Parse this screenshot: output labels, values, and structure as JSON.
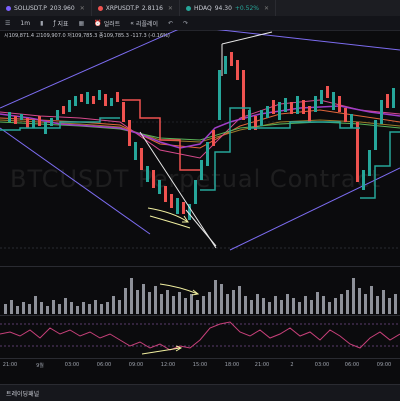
{
  "tabs": [
    {
      "symbol": "SOLUSDT.P",
      "price": "203.960",
      "change": "",
      "color": "#7b61ff"
    },
    {
      "symbol": "XRPUSDT.P",
      "price": "2.8116",
      "change": "",
      "color": "#ef5350"
    },
    {
      "symbol": "HDAQ",
      "price": "94.30",
      "change": "+0.52%",
      "color": "#26a69a"
    }
  ],
  "toolbar": {
    "interval": "1m",
    "indicators": "지표",
    "alerts": "얼러트",
    "layout": "리플레이"
  },
  "legend": {
    "text": "시109,871.4 고109,907.0 저109,785.3 종109,785.3 -117.3 (-0.16%)"
  },
  "watermark": "BTCUSDT Perpetual Contract",
  "time_axis": [
    "21:00",
    "9월",
    "03:00",
    "06:00",
    "09:00",
    "12:00",
    "15:00",
    "18:00",
    "21:00",
    "2",
    "03:00",
    "06:00",
    "09:00"
  ],
  "bottom_bar": {
    "label": "트레이딩패널"
  },
  "colors": {
    "up": "#26a69a",
    "down": "#ef5350",
    "channel": "#7c6cf0",
    "annotation": "#f2f0a0"
  }
}
